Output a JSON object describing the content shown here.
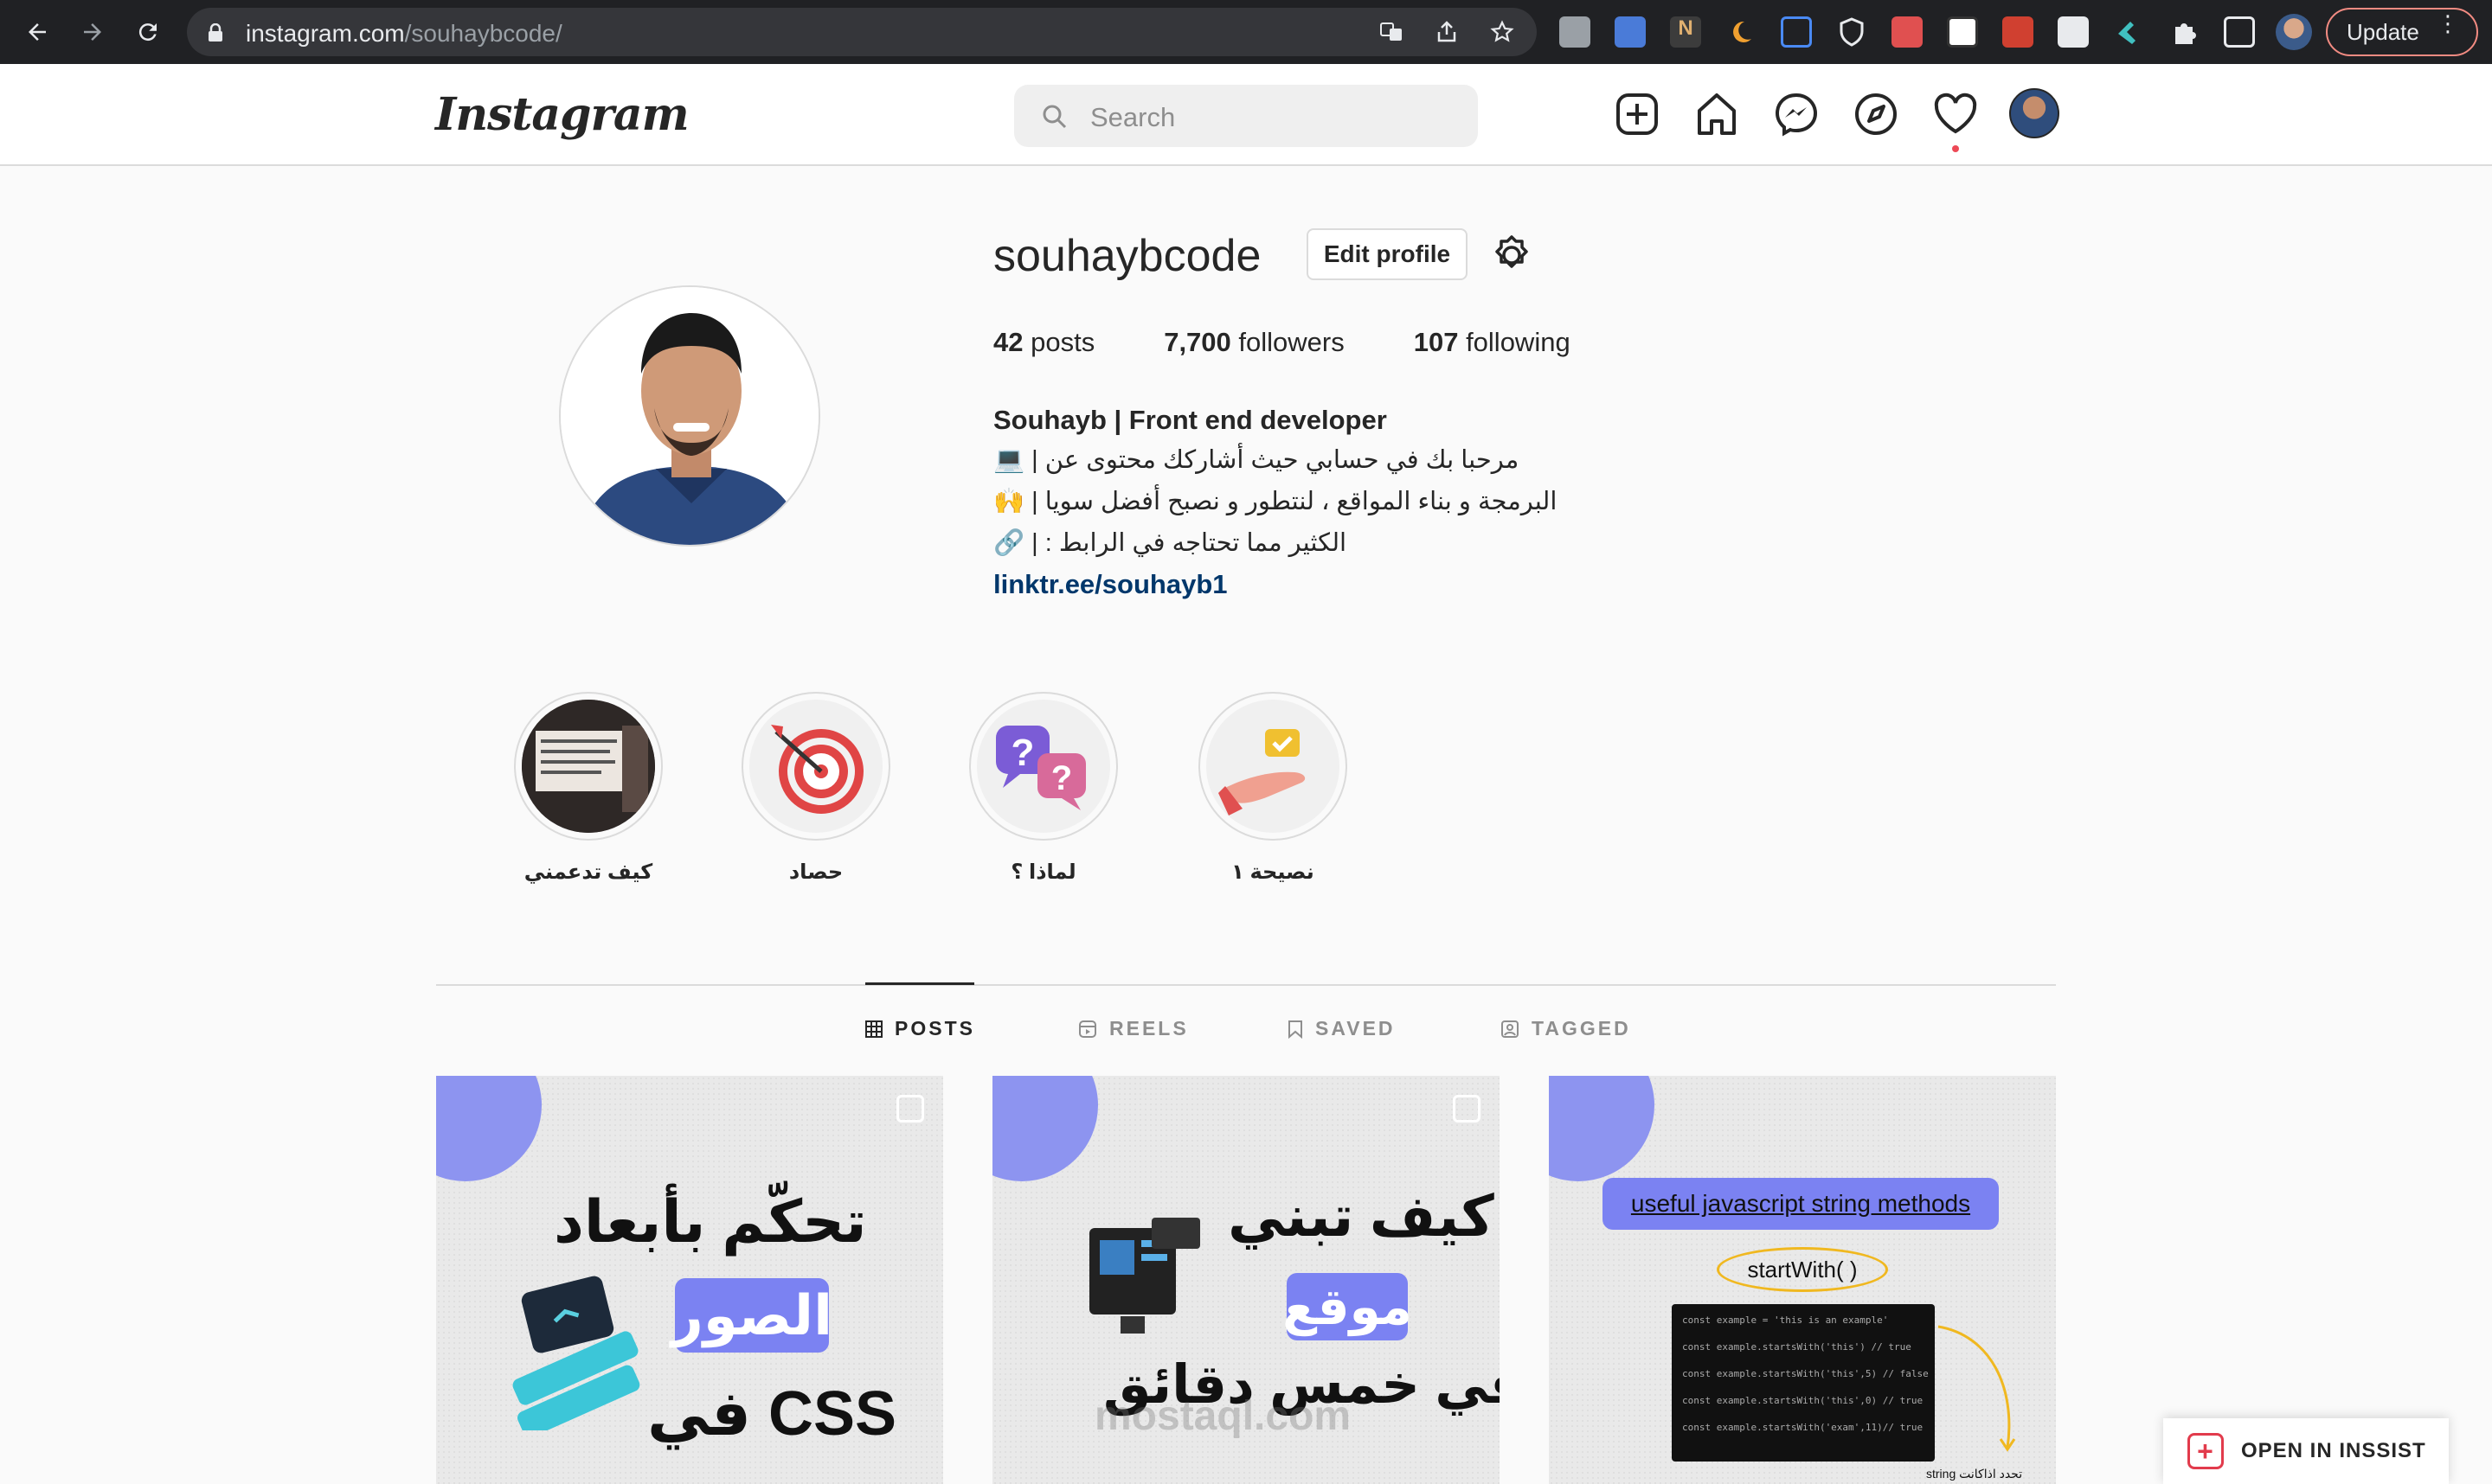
{
  "browser": {
    "url_host": "instagram.com",
    "url_path": "/souhaybcode/",
    "update_label": "Update",
    "update_dots": "⋮"
  },
  "header": {
    "logo": "Instagram",
    "search_placeholder": "Search"
  },
  "profile": {
    "username": "souhaybcode",
    "edit_label": "Edit profile",
    "posts_count": "42",
    "posts_label": " posts",
    "followers_count": "7,700",
    "followers_label": " followers",
    "following_count": "107",
    "following_label": " following",
    "bio_name": "Souhayb | Front end developer",
    "bio_lines": [
      "💻 | مرحبا بك في حسابي حيث أشاركك محتوى عن",
      "🙌 | البرمجة و بناء المواقع ، لنتطور و نصبح أفضل سويا",
      "🔗 | : الكثير مما تحتاجه في الرابط"
    ],
    "bio_link": "linktr.ee/souhayb1"
  },
  "highlights": [
    {
      "label": "كيف تدعمني"
    },
    {
      "label": "حصاد"
    },
    {
      "label": "لماذا ؟"
    },
    {
      "label": "نصيحة ١"
    }
  ],
  "tabs": [
    {
      "label": "POSTS"
    },
    {
      "label": "REELS"
    },
    {
      "label": "SAVED"
    },
    {
      "label": "TAGGED"
    }
  ],
  "posts": [
    {
      "line1": "تحكّم بأبعاد",
      "pill": "الصور",
      "line3": "في CSS"
    },
    {
      "line1": "كيف تبني",
      "pill": "موقع",
      "line3": "في خمس دقائق",
      "watermark": "mostaql.com"
    },
    {
      "title": "useful javascript string methods",
      "method": "startWith( )",
      "code": [
        "const example = 'this is an example'",
        "const example.startsWith('this') // true",
        "const example.startsWith('this',5) // false",
        "const example.startsWith('this',0) // true",
        "const example.startsWith('exam',11)// true"
      ],
      "note": "string تحدد اذاكانت"
    }
  ],
  "inssist": {
    "label": "OPEN IN INSSIST"
  }
}
